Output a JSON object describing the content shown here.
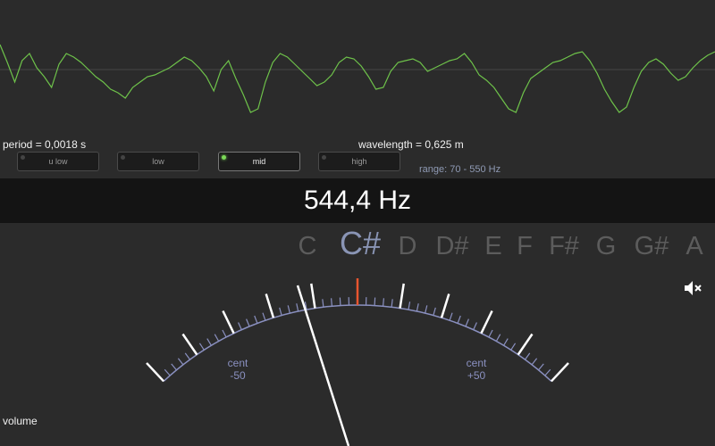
{
  "wave": {
    "color": "#6ec24a",
    "points": [
      10,
      30,
      52,
      28,
      20,
      36,
      46,
      58,
      32,
      20,
      24,
      30,
      38,
      46,
      52,
      60,
      64,
      70,
      58,
      52,
      46,
      44,
      40,
      36,
      30,
      24,
      28,
      36,
      46,
      62,
      38,
      28,
      48,
      66,
      86,
      82,
      52,
      30,
      20,
      24,
      32,
      40,
      48,
      56,
      52,
      44,
      30,
      24,
      26,
      34,
      46,
      60,
      58,
      40,
      30,
      28,
      26,
      30,
      40,
      36,
      32,
      28,
      26,
      20,
      30,
      44,
      50,
      58,
      70,
      82,
      86,
      64,
      48,
      42,
      36,
      30,
      28,
      24,
      20,
      18,
      28,
      42,
      60,
      74,
      86,
      80,
      58,
      40,
      30,
      26,
      32,
      42,
      50,
      46,
      36,
      28,
      22,
      18
    ]
  },
  "period_text": "period = 0,0018 s",
  "wavelength_text": "wavelength = 0,625 m",
  "range_buttons": [
    {
      "label": "u low",
      "active": false
    },
    {
      "label": "low",
      "active": false
    },
    {
      "label": "mid",
      "active": true
    },
    {
      "label": "high",
      "active": false
    }
  ],
  "range_text": "range: 70 - 550 Hz",
  "frequency": "544,4 Hz",
  "notes": [
    "C",
    "C#",
    "D",
    "D#",
    "E",
    "F",
    "F#",
    "G",
    "G#",
    "A"
  ],
  "active_note_index": 1,
  "gauge": {
    "left_label_top": "cent",
    "left_label_bottom": "-50",
    "right_label_top": "cent",
    "right_label_bottom": "+50",
    "needle_cents": -30,
    "center_mark_color": "#e8552f",
    "scale_color": "#8a90c0"
  },
  "volume_label": "volume",
  "icons": {
    "mute": "speaker-muted-icon"
  }
}
